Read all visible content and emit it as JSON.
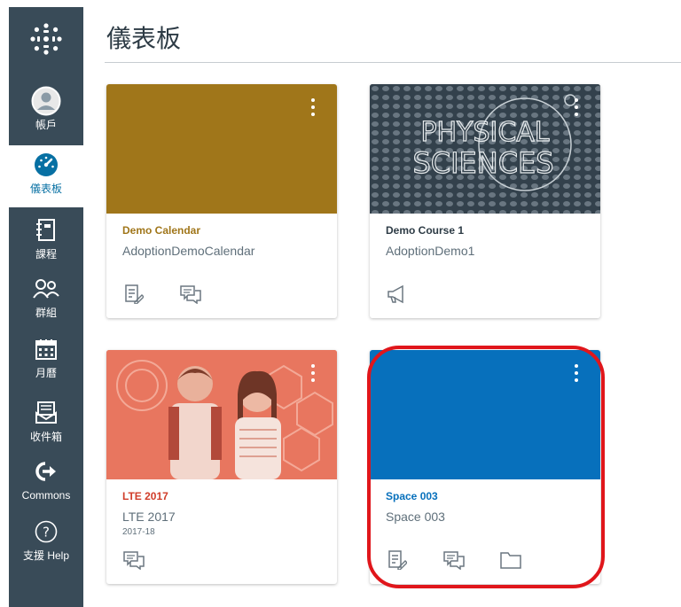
{
  "header": {
    "title": "儀表板"
  },
  "sidebar": {
    "items": [
      {
        "id": "account",
        "label": "帳戶"
      },
      {
        "id": "dashboard",
        "label": "儀表板"
      },
      {
        "id": "courses",
        "label": "課程"
      },
      {
        "id": "groups",
        "label": "群組"
      },
      {
        "id": "calendar",
        "label": "月曆"
      },
      {
        "id": "inbox",
        "label": "收件箱"
      },
      {
        "id": "commons",
        "label": "Commons"
      },
      {
        "id": "help",
        "label": "支援 Help"
      }
    ]
  },
  "cards": [
    {
      "title": "Demo Calendar",
      "subtitle": "AdoptionDemoCalendar",
      "term": "",
      "color": "#a0761a",
      "title_color": "#a0761a",
      "image": ""
    },
    {
      "title": "Demo Course 1",
      "subtitle": "AdoptionDemo1",
      "term": "",
      "color": "#3e4d57",
      "title_color": "#2d3b45",
      "image": "PHYSICAL SCIENCES"
    },
    {
      "title": "LTE 2017",
      "subtitle": "LTE 2017",
      "term": "2017-18",
      "color": "#e8765f",
      "title_color": "#d03d2a",
      "image": ""
    },
    {
      "title": "Space 003",
      "subtitle": "Space 003",
      "term": "",
      "color": "#0770bc",
      "title_color": "#0770bc",
      "image": ""
    }
  ],
  "colors": {
    "sidebar_bg": "#394b58",
    "active_nav": "#0770a3",
    "highlight": "#e0161b"
  }
}
